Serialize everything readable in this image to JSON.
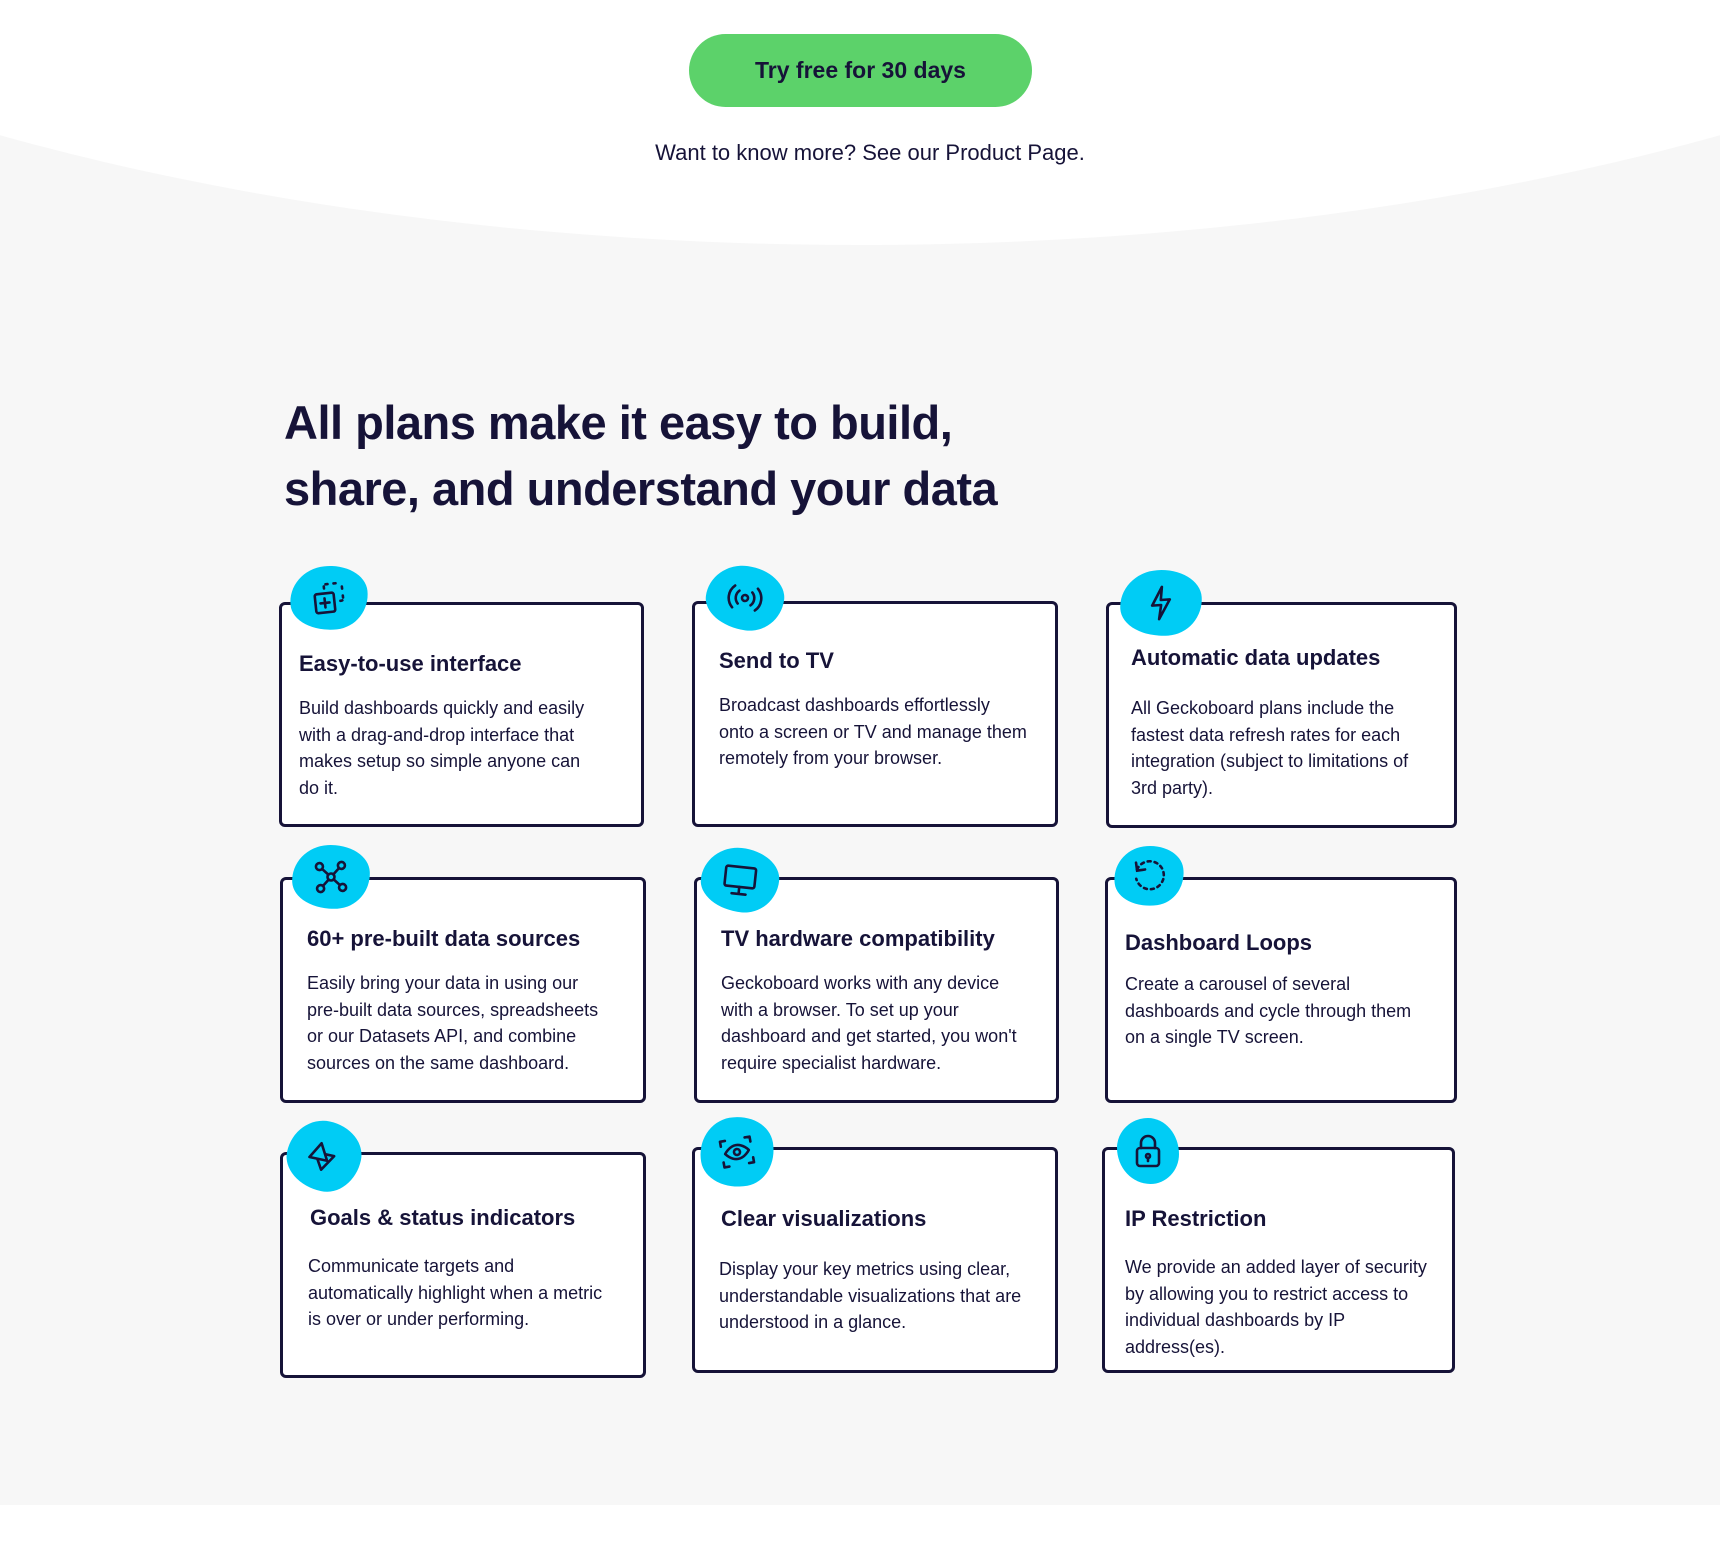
{
  "hero": {
    "cta_label": "Try free for 30 days",
    "more_prefix": "Want to know more? See our ",
    "more_link": "Product Page",
    "more_suffix": "."
  },
  "section": {
    "title_line1": "All plans make it easy to build,",
    "title_line2": "share, and understand your data"
  },
  "colors": {
    "accent_green": "#5cd26a",
    "icon_blob": "#00ccf5",
    "ink": "#161338",
    "page_bg": "#f7f7f7"
  },
  "features": [
    {
      "icon": "add-widget-icon",
      "title": "Easy-to-use interface",
      "lines": [
        "Build dashboards quickly and easily",
        "with a drag-and-drop interface that",
        "makes setup so simple anyone can",
        "do it."
      ]
    },
    {
      "icon": "broadcast-icon",
      "title": "Send to TV",
      "lines": [
        "Broadcast dashboards effortlessly",
        "onto a screen or TV and manage them",
        "remotely from your browser."
      ]
    },
    {
      "icon": "lightning-icon",
      "title": "Automatic data updates",
      "lines": [
        "All Geckoboard plans include the",
        "fastest data refresh rates for each",
        "integration (subject to limitations of",
        "3rd party)."
      ]
    },
    {
      "icon": "network-icon",
      "title": "60+ pre-built data sources",
      "lines": [
        "Easily bring your data in using our",
        "pre-built data sources, spreadsheets",
        "or our Datasets API, and combine",
        "sources on the same dashboard."
      ]
    },
    {
      "icon": "monitor-icon",
      "title": "TV hardware compatibility",
      "lines": [
        "Geckoboard works with any device",
        "with a browser. To set up your",
        "dashboard and get started, you won't",
        "require specialist hardware."
      ]
    },
    {
      "icon": "loop-icon",
      "title": "Dashboard Loops",
      "lines": [
        "Create a carousel of several",
        "dashboards and cycle through them",
        "on a single TV screen."
      ]
    },
    {
      "icon": "status-triangle-icon",
      "title": "Goals & status indicators",
      "lines": [
        "Communicate targets and",
        "automatically highlight when a metric",
        "is over or under performing."
      ]
    },
    {
      "icon": "eye-scan-icon",
      "title": "Clear visualizations",
      "lines": [
        "Display your key metrics using clear,",
        "understandable visualizations that are",
        "understood in a glance."
      ]
    },
    {
      "icon": "padlock-icon",
      "title": "IP Restriction",
      "lines": [
        "We provide an added layer of security",
        "by allowing you to restrict access to",
        "individual dashboards by IP",
        "address(es)."
      ]
    }
  ]
}
